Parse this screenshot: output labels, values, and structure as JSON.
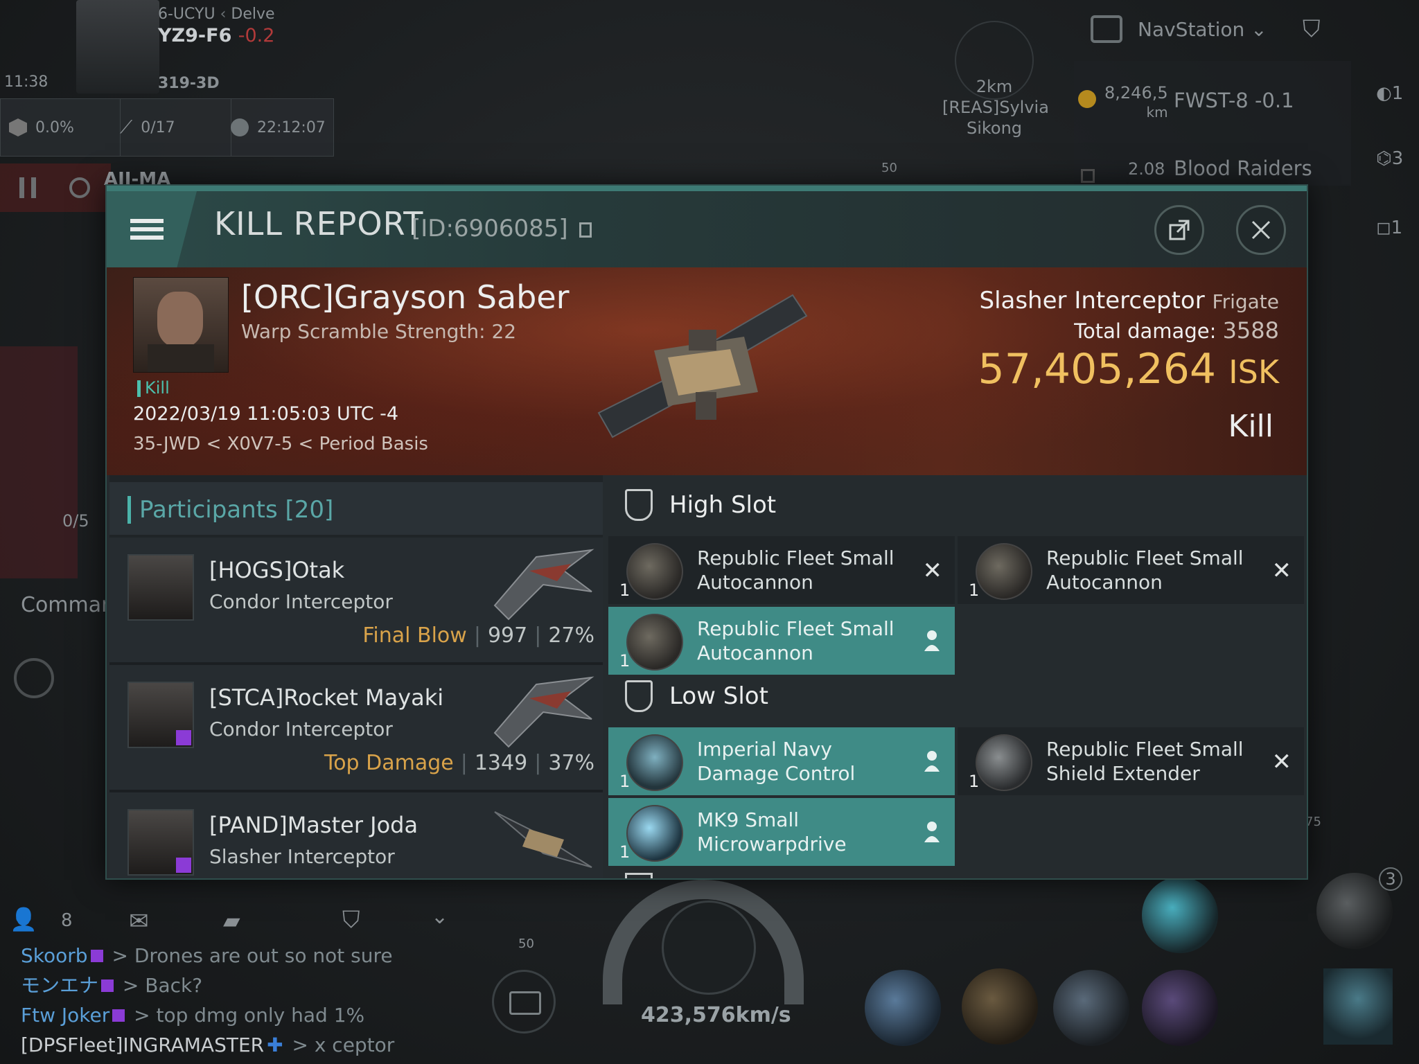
{
  "hud": {
    "region": "6-UCYU",
    "constellation": "Delve",
    "system": "YZ9-F6",
    "security": "-0.2",
    "clock": "11:38",
    "route_next": "319-3D",
    "cargo_pct": "0.0%",
    "count": "0/17",
    "timer": "22:12:07",
    "nav_system": "AJI-MA",
    "navstation_label": "NavStation",
    "overview_row1_dist": "8,246,5",
    "overview_row1_unit": "km",
    "overview_row1_name": "FWST-8 -0.1",
    "overview_row2_dist": "2.08",
    "overview_row2_name": "Blood Raiders",
    "target_dist": "2km",
    "target_name": "[REAS]Sylvia Sikong",
    "side_count_1": "1",
    "side_count_2": "3",
    "side_count_3": "1",
    "command_label": "Comman",
    "drone_count": "0/5",
    "speed": "423,576km/s",
    "module_count": "3",
    "compass_50a": "50",
    "compass_50b": "50",
    "compass_75": "75"
  },
  "chat": {
    "members": "8",
    "messages": [
      {
        "who": "Skoorb",
        "text": "> Drones are out so not sure"
      },
      {
        "who": "モンエナ",
        "text": "> Back?"
      },
      {
        "who": "Ftw Joker",
        "text": "> top dmg only had 1%"
      },
      {
        "who": "[DPSFleet]INGRAMASTER",
        "text": "> x ceptor"
      }
    ]
  },
  "report": {
    "title": "KILL REPORT",
    "id": "[ID:6906085]",
    "victim_name": "[ORC]Grayson Saber",
    "victim_sub": "Warp Scramble Strength: 22",
    "kill_tag": "Kill",
    "datetime": "2022/03/19 11:05:03 UTC -4",
    "location": "35-JWD < X0V7-5 < Period Basis",
    "ship_name": "Slasher Interceptor",
    "ship_class": "Frigate",
    "total_damage_label": "Total damage:",
    "total_damage": "3588",
    "isk_value": "57,405,264",
    "isk_unit": "ISK",
    "kill_type": "Kill"
  },
  "participants": {
    "label": "Participants",
    "count": "[20]",
    "rows": [
      {
        "name": "[HOGS]Otak",
        "ship": "Condor Interceptor",
        "tag": "Final Blow",
        "damage": "997",
        "pct": "27%"
      },
      {
        "name": "[STCA]Rocket Mayaki",
        "ship": "Condor Interceptor",
        "tag": "Top Damage",
        "damage": "1349",
        "pct": "37%"
      },
      {
        "name": "[PAND]Master Joda",
        "ship": "Slasher Interceptor",
        "tag": "",
        "damage": "",
        "pct": ""
      }
    ]
  },
  "fitting": {
    "high_label": "High Slot",
    "low_label": "Low Slot",
    "high": [
      {
        "name": "Republic Fleet Small Autocannon",
        "qty": "1",
        "state": "destroyed"
      },
      {
        "name": "Republic Fleet Small Autocannon",
        "qty": "1",
        "state": "destroyed"
      },
      {
        "name": "Republic Fleet Small Autocannon",
        "qty": "1",
        "state": "dropped"
      }
    ],
    "low": [
      {
        "name": "Imperial Navy Damage Control",
        "qty": "1",
        "state": "dropped"
      },
      {
        "name": "Republic Fleet Small Shield Extender",
        "qty": "1",
        "state": "destroyed"
      },
      {
        "name": "MK9 Small Microwarpdrive",
        "qty": "1",
        "state": "dropped"
      }
    ]
  },
  "colors": {
    "accent": "#3f8b86",
    "isk": "#f0c060",
    "final_blow": "#d9a34a",
    "kill_tag": "#4cc0ad"
  }
}
